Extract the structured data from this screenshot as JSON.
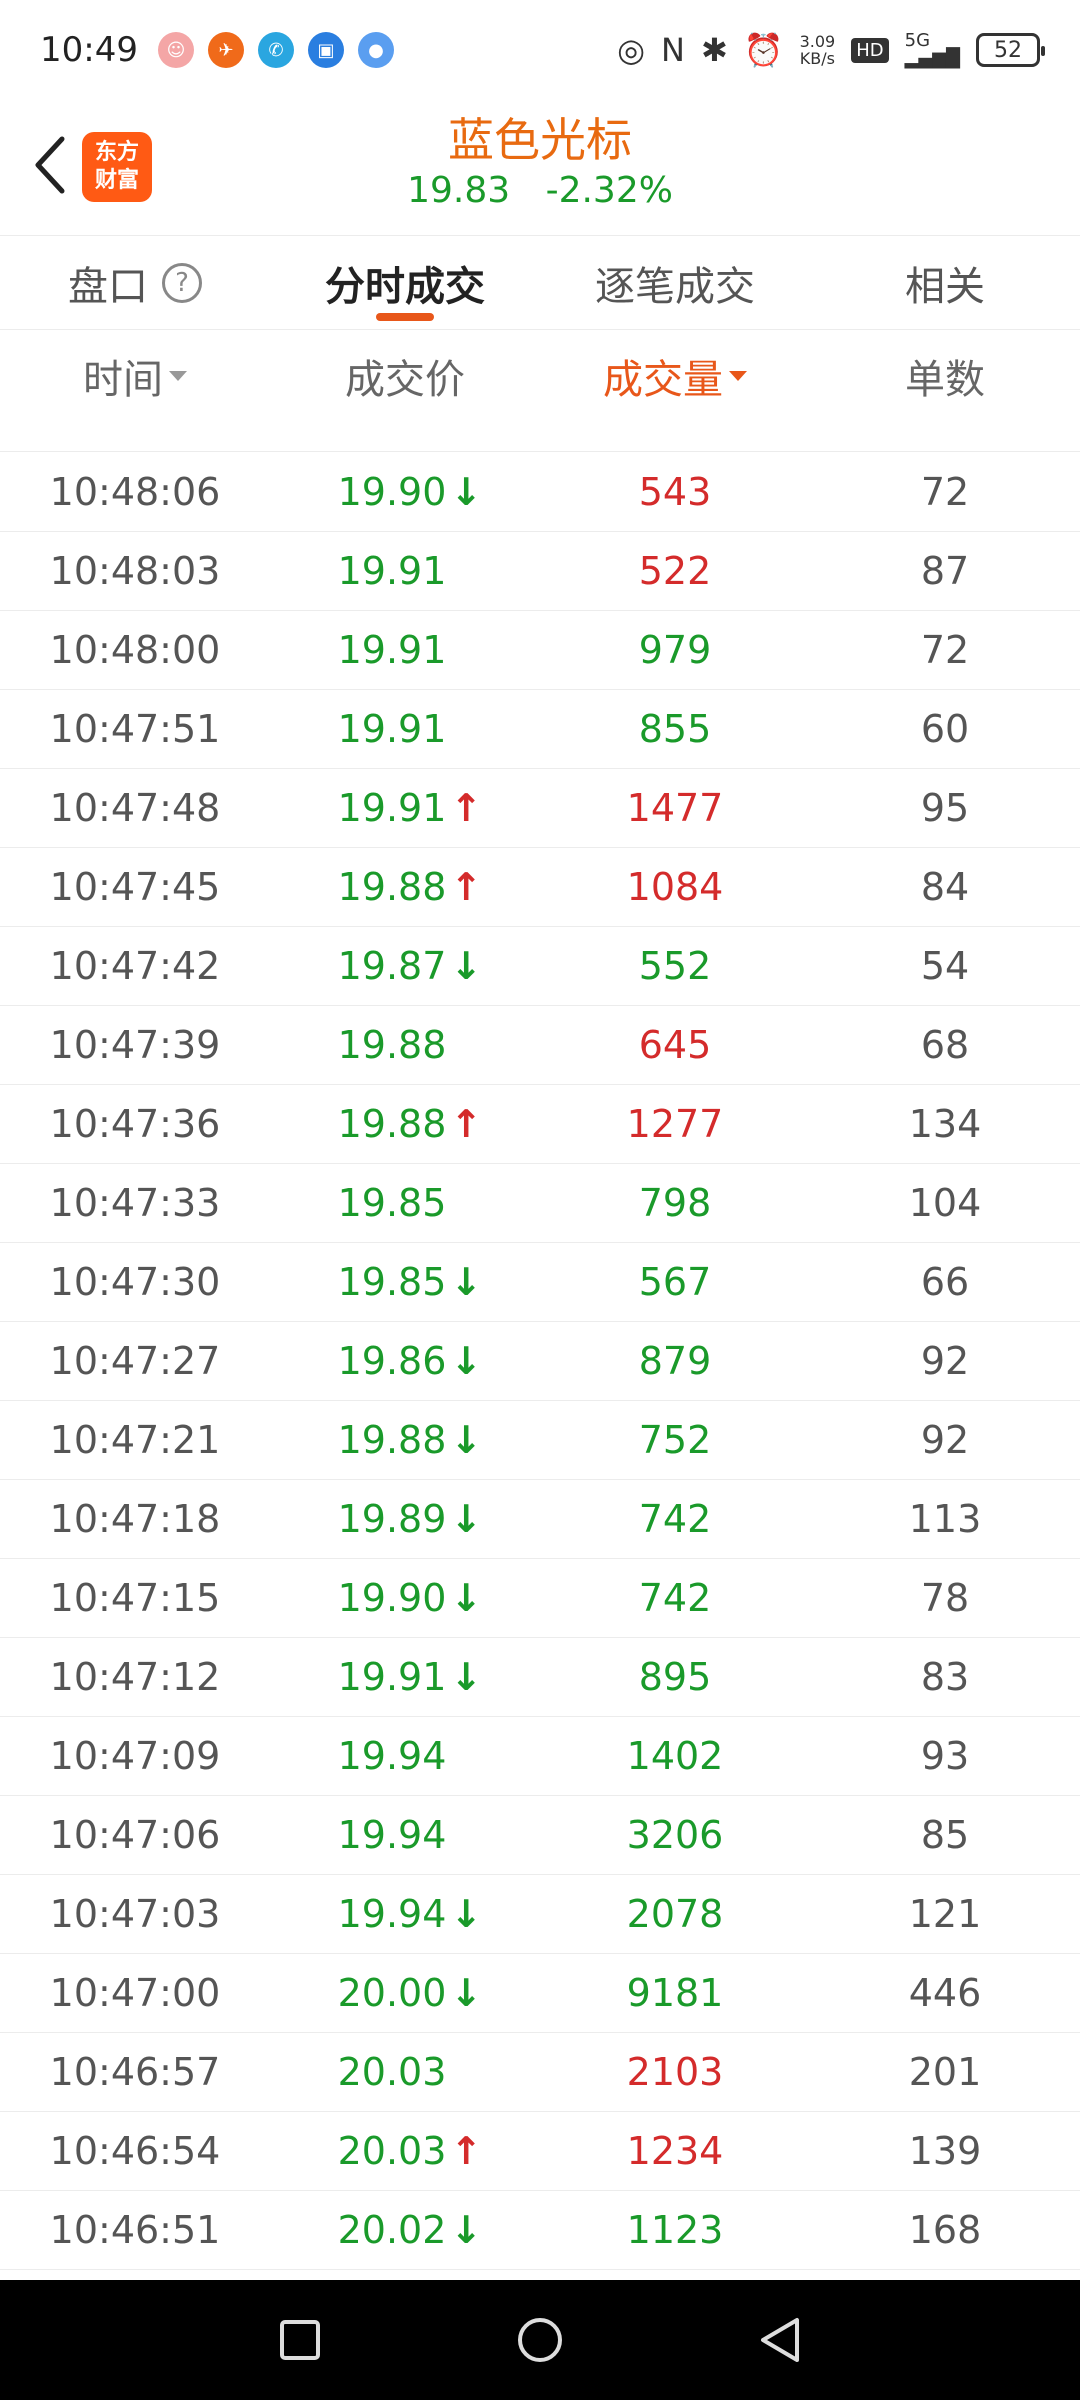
{
  "status_bar": {
    "time": "10:49",
    "net_speed": "3.09",
    "net_unit": "KB/s",
    "hd": "HD",
    "signal": "5G",
    "battery": "52"
  },
  "header": {
    "logo_line1": "东方",
    "logo_line2": "财富",
    "title": "蓝色光标",
    "price": "19.83",
    "change": "-2.32%"
  },
  "tabs": [
    {
      "label": "盘口",
      "active": false
    },
    {
      "label": "分时成交",
      "active": true
    },
    {
      "label": "逐笔成交",
      "active": false
    },
    {
      "label": "相关",
      "active": false
    }
  ],
  "columns": {
    "time": "时间",
    "price": "成交价",
    "volume": "成交量",
    "count": "单数"
  },
  "colors": {
    "up": "#d42b2b",
    "down": "#1a9a2a",
    "accent": "#e8571a"
  },
  "trades": [
    {
      "time": "10:48:06",
      "price": "19.90",
      "dir": "down",
      "volume": "543",
      "vol_color": "red",
      "count": "72"
    },
    {
      "time": "10:48:03",
      "price": "19.91",
      "dir": "",
      "volume": "522",
      "vol_color": "red",
      "count": "87"
    },
    {
      "time": "10:48:00",
      "price": "19.91",
      "dir": "",
      "volume": "979",
      "vol_color": "green",
      "count": "72"
    },
    {
      "time": "10:47:51",
      "price": "19.91",
      "dir": "",
      "volume": "855",
      "vol_color": "green",
      "count": "60"
    },
    {
      "time": "10:47:48",
      "price": "19.91",
      "dir": "up",
      "volume": "1477",
      "vol_color": "red",
      "count": "95"
    },
    {
      "time": "10:47:45",
      "price": "19.88",
      "dir": "up",
      "volume": "1084",
      "vol_color": "red",
      "count": "84"
    },
    {
      "time": "10:47:42",
      "price": "19.87",
      "dir": "down",
      "volume": "552",
      "vol_color": "green",
      "count": "54"
    },
    {
      "time": "10:47:39",
      "price": "19.88",
      "dir": "",
      "volume": "645",
      "vol_color": "red",
      "count": "68"
    },
    {
      "time": "10:47:36",
      "price": "19.88",
      "dir": "up",
      "volume": "1277",
      "vol_color": "red",
      "count": "134"
    },
    {
      "time": "10:47:33",
      "price": "19.85",
      "dir": "",
      "volume": "798",
      "vol_color": "green",
      "count": "104"
    },
    {
      "time": "10:47:30",
      "price": "19.85",
      "dir": "down",
      "volume": "567",
      "vol_color": "green",
      "count": "66"
    },
    {
      "time": "10:47:27",
      "price": "19.86",
      "dir": "down",
      "volume": "879",
      "vol_color": "green",
      "count": "92"
    },
    {
      "time": "10:47:21",
      "price": "19.88",
      "dir": "down",
      "volume": "752",
      "vol_color": "green",
      "count": "92"
    },
    {
      "time": "10:47:18",
      "price": "19.89",
      "dir": "down",
      "volume": "742",
      "vol_color": "green",
      "count": "113"
    },
    {
      "time": "10:47:15",
      "price": "19.90",
      "dir": "down",
      "volume": "742",
      "vol_color": "green",
      "count": "78"
    },
    {
      "time": "10:47:12",
      "price": "19.91",
      "dir": "down",
      "volume": "895",
      "vol_color": "green",
      "count": "83"
    },
    {
      "time": "10:47:09",
      "price": "19.94",
      "dir": "",
      "volume": "1402",
      "vol_color": "green",
      "count": "93"
    },
    {
      "time": "10:47:06",
      "price": "19.94",
      "dir": "",
      "volume": "3206",
      "vol_color": "green",
      "count": "85"
    },
    {
      "time": "10:47:03",
      "price": "19.94",
      "dir": "down",
      "volume": "2078",
      "vol_color": "green",
      "count": "121"
    },
    {
      "time": "10:47:00",
      "price": "20.00",
      "dir": "down",
      "volume": "9181",
      "vol_color": "green",
      "count": "446"
    },
    {
      "time": "10:46:57",
      "price": "20.03",
      "dir": "",
      "volume": "2103",
      "vol_color": "red",
      "count": "201"
    },
    {
      "time": "10:46:54",
      "price": "20.03",
      "dir": "up",
      "volume": "1234",
      "vol_color": "red",
      "count": "139"
    },
    {
      "time": "10:46:51",
      "price": "20.02",
      "dir": "down",
      "volume": "1123",
      "vol_color": "green",
      "count": "168"
    }
  ]
}
